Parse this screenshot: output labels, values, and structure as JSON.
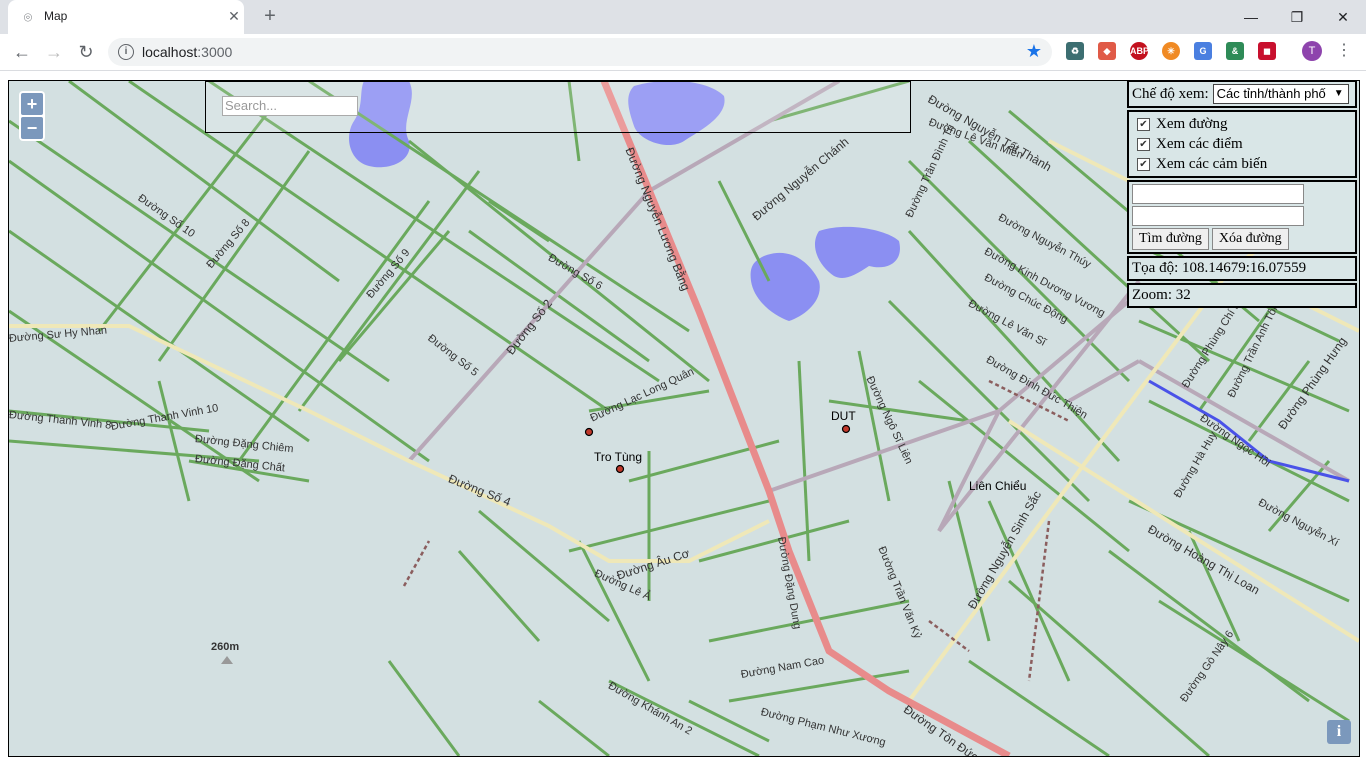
{
  "browser": {
    "tab_title": "Map",
    "url_host": "localhost",
    "url_port": ":3000",
    "profile_initial": "T"
  },
  "map": {
    "search_placeholder": "Search...",
    "zoom_in": "+",
    "zoom_out": "−",
    "scale_label": "260m",
    "attribution_icon": "i",
    "places": [
      "DUT",
      "Tro Tùng",
      "Liên Chiểu"
    ],
    "street_labels": [
      "Đường Nguyễn Lương Bằng",
      "Đường Nguyễn Chánh",
      "Đường Nguyễn Tất Thành",
      "Đường Số 2",
      "Đường Số 4",
      "Đường Âu Cơ",
      "Đường Lạc Long Quân",
      "Đường Nguyễn Sinh Sắc",
      "Đường Hoàng Thị Loan",
      "Đường Tôn Đức Thắng",
      "Đường Thanh Vinh 10",
      "Đường Đặng Chiêm",
      "Đường Đặng Chất",
      "Đường Thanh Vinh 8",
      "Đường Nam Cao",
      "Đường Phạm Như Xương",
      "Đường Khánh An 2",
      "Đường Đinh Đức Thiện",
      "Đường Phùng Hưng",
      "Đường Ngô Sĩ Liên",
      "Đường Trần Văn Kỷ",
      "Đường Số 6",
      "Đường Số 5",
      "Đường Số 8",
      "Đường Số 9",
      "Đường Số 10",
      "Đường Lê Văn Miến",
      "Đường Trần Đình Tri",
      "Đường Nguyễn Thúy",
      "Đường Kinh Dương Vương",
      "Đường Chúc Động",
      "Đường Lê Văn Sĩ",
      "Đường Phùng Chí Kiên",
      "Đường Trần Anh Tông",
      "Đường Ngọc Hồi",
      "Đường Hà Huy",
      "Đường Nguyễn Xí",
      "Đường Gò Nây 6",
      "Đường Đặng Dung",
      "Đường Lê Ả",
      "Đường Sư Hy Nhan"
    ]
  },
  "panel": {
    "view_mode_label": "Chế độ xem:",
    "view_mode_value": "Các tỉnh/thành phố",
    "checkbox_roads": "Xem đường",
    "checkbox_points": "Xem các điểm",
    "checkbox_sensors": "Xem các cảm biến",
    "find_route_button": "Tìm đường",
    "clear_route_button": "Xóa đường",
    "coords_text": "Tọa độ: 108.14679:16.07559",
    "zoom_text": "Zoom: 32"
  },
  "colors": {
    "map_background": "#d3e0e1",
    "road_minor": "#6aa95d",
    "road_major": "#e88b8b",
    "road_secondary": "#efe8b8",
    "road_tertiary": "#b8a8b8",
    "water": "#8b8ff2",
    "panel_background": "#d9e6e7"
  }
}
